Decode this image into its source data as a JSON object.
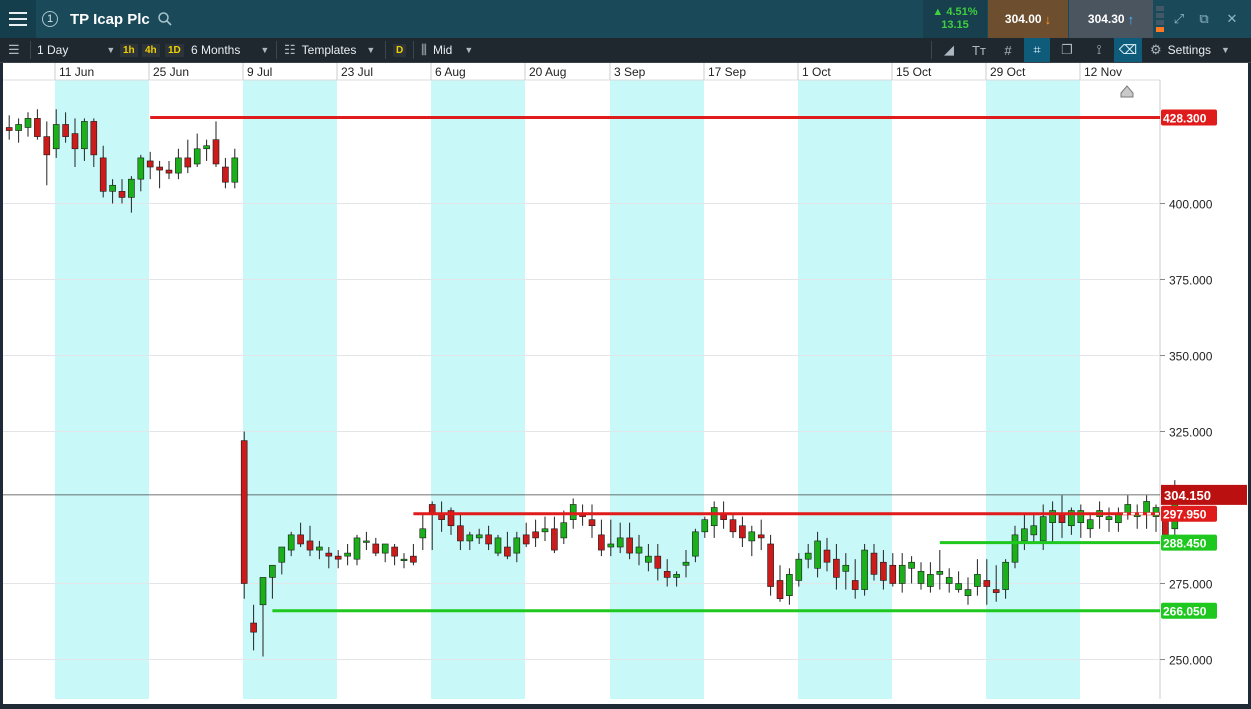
{
  "header": {
    "title": "TP Icap Plc",
    "change_pct": "▲ 4.51%",
    "change_abs": "13.15",
    "bid": "304.00",
    "ask": "304.30"
  },
  "toolbar": {
    "interval": "1 Day",
    "quick_intervals": [
      "1h",
      "4h",
      "1D"
    ],
    "range": "6 Months",
    "templates_label": "Templates",
    "d_label": "D",
    "price_type": "Mid",
    "settings_label": "Settings"
  },
  "colors": {
    "bull": "#1bb01b",
    "bear": "#cc1b1b",
    "band": "#c8f8f8",
    "resistance": "#e01b1b",
    "support": "#1ec81e"
  },
  "chart_data": {
    "type": "candlestick",
    "ylim": [
      244,
      440
    ],
    "y_ticks": [
      "250.000",
      "275.000",
      "325.000",
      "350.000",
      "375.000",
      "400.000"
    ],
    "x_ticks": [
      "11 Jun",
      "25 Jun",
      "9 Jul",
      "23 Jul",
      "6 Aug",
      "20 Aug",
      "3 Sep",
      "17 Sep",
      "1 Oct",
      "15 Oct",
      "29 Oct",
      "12 Nov"
    ],
    "shaded_periods": [
      "11 Jun",
      "9 Jul",
      "6 Aug",
      "3 Sep",
      "1 Oct",
      "29 Oct"
    ],
    "current_price": 304.15,
    "current_price_label": "304.150",
    "horizontal_levels": [
      {
        "value": 428.3,
        "label": "428.300",
        "color": "#e01b1b",
        "start": 15,
        "style": "solid"
      },
      {
        "value": 297.95,
        "label": "297.950",
        "color": "#e01b1b",
        "start": 43,
        "style": "solid"
      },
      {
        "value": 288.45,
        "label": "288.450",
        "color": "#1ec81e",
        "start": 99,
        "style": "solid"
      },
      {
        "value": 266.05,
        "label": "266.050",
        "color": "#1ec81e",
        "start": 28,
        "style": "solid"
      }
    ],
    "candles": [
      [
        425,
        429,
        421,
        424
      ],
      [
        424,
        428,
        420,
        426
      ],
      [
        425,
        430,
        422,
        428
      ],
      [
        428,
        431,
        421,
        422
      ],
      [
        422,
        427,
        406,
        416
      ],
      [
        418,
        431,
        415,
        426
      ],
      [
        426,
        430,
        420,
        422
      ],
      [
        423,
        428,
        412,
        418
      ],
      [
        418,
        428,
        414,
        427
      ],
      [
        427,
        428,
        412,
        416
      ],
      [
        415,
        419,
        402,
        404
      ],
      [
        404,
        408,
        400,
        406
      ],
      [
        404,
        408,
        400,
        402
      ],
      [
        402,
        409,
        397,
        408
      ],
      [
        408,
        416,
        404,
        415
      ],
      [
        414,
        417,
        408,
        412
      ],
      [
        412,
        414,
        405,
        411
      ],
      [
        411,
        414,
        408,
        410
      ],
      [
        410,
        418,
        408,
        415
      ],
      [
        415,
        421,
        410,
        412
      ],
      [
        413,
        423,
        412,
        418
      ],
      [
        418,
        421,
        414,
        419
      ],
      [
        421,
        427,
        412,
        413
      ],
      [
        412,
        415,
        405,
        407
      ],
      [
        407,
        418,
        405,
        415
      ],
      [
        322,
        325,
        270,
        275
      ],
      [
        262,
        268,
        253,
        259
      ],
      [
        268,
        274,
        251,
        277
      ],
      [
        277,
        281,
        270,
        281
      ],
      [
        282,
        286,
        278,
        287
      ],
      [
        286,
        292,
        284,
        291
      ],
      [
        291,
        295,
        287,
        288
      ],
      [
        289,
        294,
        284,
        286
      ],
      [
        286,
        289,
        283,
        287
      ],
      [
        285,
        287,
        280,
        284
      ],
      [
        284,
        286,
        280,
        283
      ],
      [
        284,
        288,
        281,
        285
      ],
      [
        283,
        291,
        281,
        290
      ],
      [
        289,
        292,
        286,
        289
      ],
      [
        288,
        290,
        284,
        285
      ],
      [
        285,
        288,
        282,
        288
      ],
      [
        287,
        288,
        281,
        284
      ],
      [
        283,
        285,
        280,
        283
      ],
      [
        284,
        288,
        281,
        282
      ],
      [
        290,
        298,
        286,
        293
      ],
      [
        301,
        302,
        286,
        298
      ],
      [
        298,
        302,
        292,
        296
      ],
      [
        299,
        300,
        291,
        294
      ],
      [
        294,
        298,
        286,
        289
      ],
      [
        289,
        292,
        286,
        291
      ],
      [
        290,
        293,
        288,
        291
      ],
      [
        291,
        294,
        286,
        288
      ],
      [
        285,
        291,
        284,
        290
      ],
      [
        287,
        292,
        283,
        284
      ],
      [
        285,
        292,
        282,
        290
      ],
      [
        291,
        295,
        287,
        288
      ],
      [
        292,
        296,
        287,
        290
      ],
      [
        292,
        297,
        289,
        293
      ],
      [
        293,
        297,
        285,
        286
      ],
      [
        290,
        299,
        288,
        295
      ],
      [
        296,
        303,
        293,
        301
      ],
      [
        298,
        301,
        294,
        297
      ],
      [
        296,
        301,
        290,
        294
      ],
      [
        291,
        296,
        284,
        286
      ],
      [
        287,
        296,
        284,
        288
      ],
      [
        287,
        295,
        285,
        290
      ],
      [
        290,
        295,
        283,
        285
      ],
      [
        285,
        291,
        281,
        287
      ],
      [
        282,
        288,
        279,
        284
      ],
      [
        284,
        288,
        276,
        280
      ],
      [
        279,
        283,
        274,
        277
      ],
      [
        277,
        279,
        274,
        278
      ],
      [
        281,
        286,
        277,
        282
      ],
      [
        284,
        293,
        282,
        292
      ],
      [
        292,
        297,
        290,
        296
      ],
      [
        294,
        302,
        290,
        300
      ],
      [
        298,
        302,
        293,
        296
      ],
      [
        296,
        298,
        290,
        292
      ],
      [
        294,
        297,
        287,
        290
      ],
      [
        289,
        294,
        284,
        292
      ],
      [
        291,
        296,
        286,
        290
      ],
      [
        288,
        291,
        271,
        274
      ],
      [
        276,
        281,
        269,
        270
      ],
      [
        271,
        280,
        268,
        278
      ],
      [
        276,
        285,
        274,
        283
      ],
      [
        283,
        288,
        280,
        285
      ],
      [
        280,
        292,
        277,
        289
      ],
      [
        286,
        290,
        279,
        282
      ],
      [
        283,
        288,
        273,
        277
      ],
      [
        279,
        285,
        273,
        281
      ],
      [
        276,
        283,
        270,
        273
      ],
      [
        273,
        288,
        271,
        286
      ],
      [
        285,
        288,
        276,
        278
      ],
      [
        282,
        286,
        273,
        276
      ],
      [
        281,
        285,
        274,
        275
      ],
      [
        275,
        285,
        272,
        281
      ],
      [
        280,
        284,
        275,
        282
      ],
      [
        275,
        282,
        273,
        279
      ],
      [
        274,
        282,
        272,
        278
      ],
      [
        278,
        286,
        273,
        279
      ],
      [
        275,
        280,
        272,
        277
      ],
      [
        273,
        279,
        272,
        275
      ],
      [
        271,
        277,
        268,
        273
      ],
      [
        274,
        283,
        271,
        278
      ],
      [
        276,
        283,
        268,
        274
      ],
      [
        273,
        281,
        269,
        272
      ],
      [
        273,
        283,
        270,
        282
      ],
      [
        282,
        294,
        280,
        291
      ],
      [
        289,
        298,
        286,
        293
      ],
      [
        291,
        298,
        288,
        294
      ],
      [
        289,
        301,
        286,
        297
      ],
      [
        295,
        302,
        288,
        299
      ],
      [
        298,
        304,
        290,
        295
      ],
      [
        294,
        300,
        291,
        299
      ],
      [
        295,
        301,
        290,
        299
      ],
      [
        293,
        298,
        290,
        296
      ],
      [
        297,
        302,
        293,
        299
      ],
      [
        296,
        300,
        292,
        297
      ],
      [
        295,
        300,
        292,
        298
      ],
      [
        298,
        304,
        296,
        301
      ],
      [
        297,
        301,
        293,
        298
      ],
      [
        298,
        304,
        293,
        302
      ],
      [
        297,
        301,
        292,
        300
      ],
      [
        297,
        300,
        288,
        291
      ],
      [
        293,
        309,
        288,
        304
      ]
    ]
  }
}
